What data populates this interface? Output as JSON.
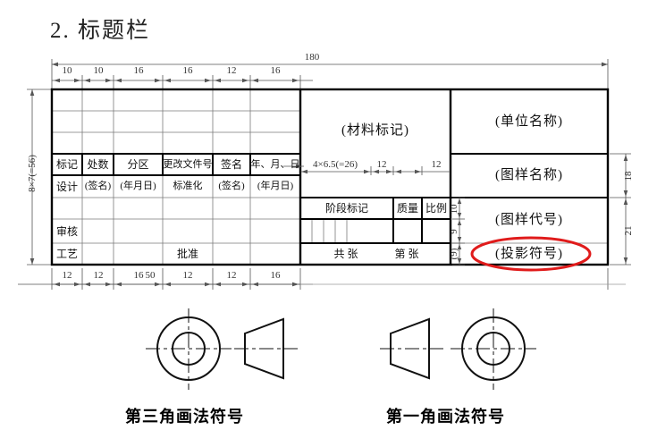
{
  "heading": "2.  标题栏",
  "title_block": {
    "overall_width_dim": "180",
    "overall_height_dim": "8×7(=56)",
    "top_dims": [
      "10",
      "10",
      "16",
      "16",
      "12",
      "16"
    ],
    "bottom_dims": [
      "12",
      "12",
      "16",
      "12",
      "12",
      "16"
    ],
    "bottom_right_dim": "50",
    "mid_dims": [
      "4×6.5(=26)",
      "12",
      "12"
    ],
    "right_dims": [
      "18",
      "21"
    ],
    "inner_right_dims": [
      "10",
      "9",
      "(9)"
    ],
    "left_table": {
      "rows": [
        [
          "",
          "",
          "",
          "",
          "",
          ""
        ],
        [
          "",
          "",
          "",
          "",
          "",
          ""
        ],
        [
          "",
          "",
          "",
          "",
          "",
          ""
        ],
        [
          "标记",
          "处数",
          "分区",
          "更改文件号",
          "签名",
          "年、月、日"
        ],
        [
          "设计",
          "(签名)",
          "(年月日)",
          "标准化",
          "(签名)",
          "(年月日)"
        ],
        [
          "",
          "",
          "",
          "",
          "",
          ""
        ],
        [
          "审核",
          "",
          "",
          "",
          "",
          ""
        ],
        [
          "工艺",
          "",
          "",
          "批准",
          "",
          ""
        ]
      ]
    },
    "middle": {
      "material_mark": "(材料标记)",
      "stage_mark": "阶段标记",
      "quality": "质量",
      "scale": "比例",
      "sheet_total": "共   张",
      "sheet_number": "第   张"
    },
    "right": {
      "unit_name": "(单位名称)",
      "drawing_name": "(图样名称)",
      "drawing_code": "(图样代号)",
      "projection_symbol": "(投影符号)"
    },
    "highlight_color": "#e01b1b"
  },
  "symbols": {
    "third_angle_caption": "第三角画法符号",
    "first_angle_caption": "第一角画法符号"
  }
}
